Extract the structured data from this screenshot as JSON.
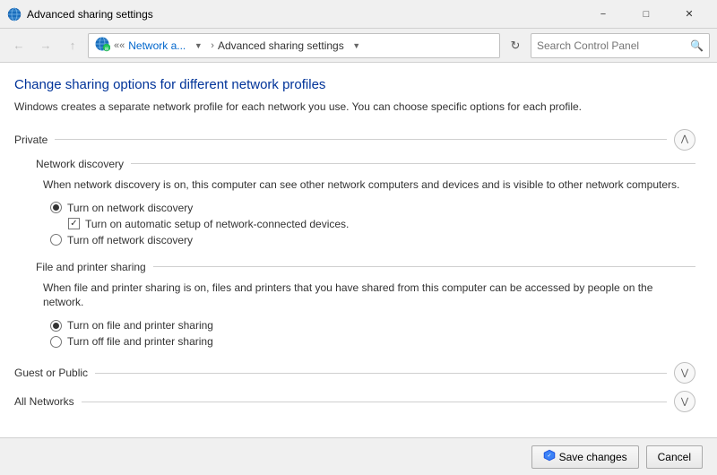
{
  "window": {
    "title": "Advanced sharing settings",
    "minimize_label": "−",
    "maximize_label": "□",
    "close_label": "✕"
  },
  "nav": {
    "back_tooltip": "Back",
    "forward_tooltip": "Forward",
    "up_tooltip": "Up",
    "breadcrumb_network": "Network a...",
    "breadcrumb_separator": "›",
    "breadcrumb_current": "Advanced sharing settings",
    "refresh_label": "⟳",
    "search_placeholder": "Search Control Panel",
    "search_icon": "🔍"
  },
  "page": {
    "title": "Change sharing options for different network profiles",
    "description": "Windows creates a separate network profile for each network you use. You can choose specific options for each profile."
  },
  "sections": [
    {
      "id": "private",
      "title": "Private",
      "expanded": true,
      "toggle_icon": "∧",
      "subsections": [
        {
          "id": "network_discovery",
          "title": "Network discovery",
          "description": "When network discovery is on, this computer can see other network computers and devices and is visible to other network computers.",
          "options": [
            {
              "type": "radio",
              "id": "turn_on_discovery",
              "label": "Turn on network discovery",
              "checked": true,
              "suboptions": [
                {
                  "type": "checkbox",
                  "id": "auto_setup",
                  "label": "Turn on automatic setup of network-connected devices.",
                  "checked": true
                }
              ]
            },
            {
              "type": "radio",
              "id": "turn_off_discovery",
              "label": "Turn off network discovery",
              "checked": false
            }
          ]
        },
        {
          "id": "file_printer_sharing",
          "title": "File and printer sharing",
          "description": "When file and printer sharing is on, files and printers that you have shared from this computer can be accessed by people on the network.",
          "options": [
            {
              "type": "radio",
              "id": "turn_on_sharing",
              "label": "Turn on file and printer sharing",
              "checked": true
            },
            {
              "type": "radio",
              "id": "turn_off_sharing",
              "label": "Turn off file and printer sharing",
              "checked": false
            }
          ]
        }
      ]
    },
    {
      "id": "guest_public",
      "title": "Guest or Public",
      "expanded": false,
      "toggle_icon": "∨"
    },
    {
      "id": "all_networks",
      "title": "All Networks",
      "expanded": false,
      "toggle_icon": "∨"
    }
  ],
  "footer": {
    "save_label": "Save changes",
    "cancel_label": "Cancel"
  }
}
